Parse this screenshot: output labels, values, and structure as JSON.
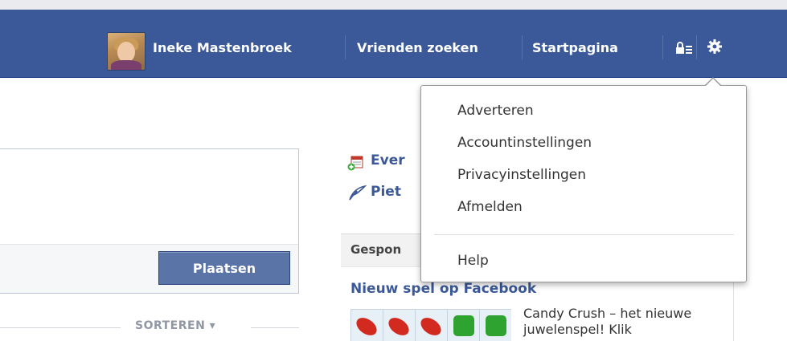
{
  "header": {
    "user_name": "Ineke Mastenbroek",
    "find_friends": "Vrienden zoeken",
    "home": "Startpagina"
  },
  "colors": {
    "brand_blue": "#3b5998",
    "link_blue": "#3b5998",
    "button_blue": "#5b74a8"
  },
  "icons": {
    "privacy": "lock-icon",
    "settings": "gear-icon",
    "event": "calendar-add-icon",
    "note": "pen-icon"
  },
  "settings_menu": {
    "items": [
      "Adverteren",
      "Accountinstellingen",
      "Privacyinstellingen",
      "Afmelden"
    ],
    "help": "Help"
  },
  "composer": {
    "post_button": "Plaatsen"
  },
  "feed": {
    "sort_label": "SORTEREN ▾"
  },
  "right_column": {
    "links": [
      "Ever",
      "Piet"
    ],
    "sponsored_label": "Gespon",
    "ad_title": "Nieuw spel op Facebook",
    "ad_text": "Candy Crush – het nieuwe juwelenspel! Klik"
  }
}
